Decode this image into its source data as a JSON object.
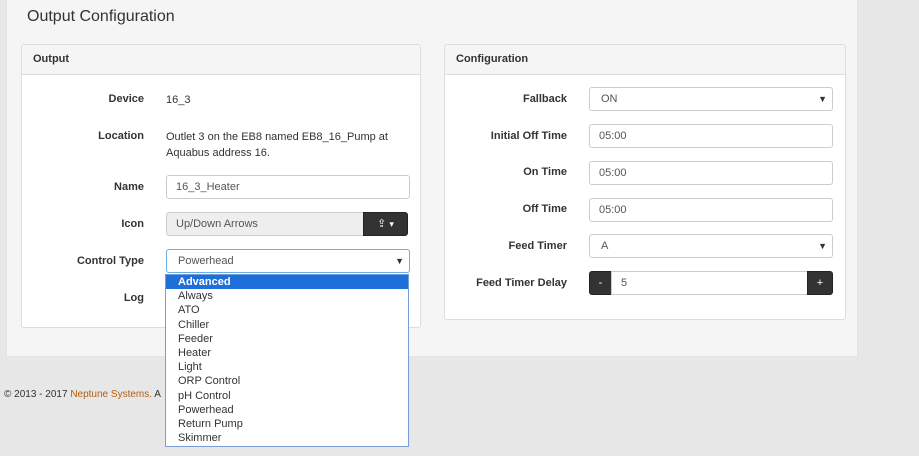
{
  "page": {
    "title": "Output Configuration"
  },
  "output_panel": {
    "heading": "Output",
    "device": {
      "label": "Device",
      "value": "16_3"
    },
    "location": {
      "label": "Location",
      "line1": "Outlet 3 on the EB8 named EB8_16_Pump at",
      "line2": "Aquabus address 16."
    },
    "name": {
      "label": "Name",
      "value": "16_3_Heater"
    },
    "icon": {
      "label": "Icon",
      "value": "Up/Down Arrows",
      "button_icon": "tree-icon",
      "caret": "▾"
    },
    "control_type": {
      "label": "Control Type",
      "selected": "Powerhead",
      "options": [
        "Advanced",
        "Always",
        "ATO",
        "Chiller",
        "Feeder",
        "Heater",
        "Light",
        "ORP Control",
        "pH Control",
        "Powerhead",
        "Return Pump",
        "Skimmer"
      ],
      "highlighted": "Advanced"
    },
    "log": {
      "label": "Log"
    }
  },
  "config_panel": {
    "heading": "Configuration",
    "fallback": {
      "label": "Fallback",
      "value": "ON"
    },
    "initial_off_time": {
      "label": "Initial Off Time",
      "value": "05:00"
    },
    "on_time": {
      "label": "On Time",
      "value": "05:00"
    },
    "off_time": {
      "label": "Off Time",
      "value": "05:00"
    },
    "feed_timer": {
      "label": "Feed Timer",
      "value": "A"
    },
    "feed_timer_delay": {
      "label": "Feed Timer Delay",
      "value": "5",
      "minus": "-",
      "plus": "+"
    }
  },
  "footer": {
    "copyright": "© 2013 - 2017 ",
    "brand": "Neptune Systems.",
    "tail": " A"
  },
  "colors": {
    "brand": "#b25d0e",
    "highlight": "#1e6fd9",
    "dark_button": "#333333"
  }
}
